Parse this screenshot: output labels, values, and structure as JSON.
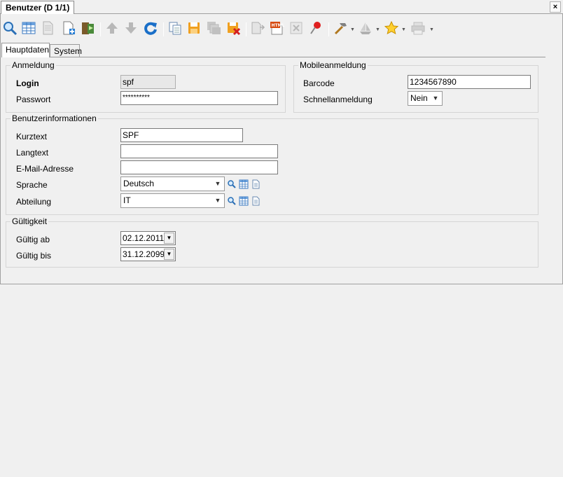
{
  "window": {
    "tab_title": "Benutzer (D 1/1)",
    "close_glyph": "×"
  },
  "tabs": [
    {
      "label": "Hauptdaten"
    },
    {
      "label": "System"
    }
  ],
  "anmeldung": {
    "title": "Anmeldung",
    "login_label": "Login",
    "login_value": "spf",
    "passwort_label": "Passwort",
    "passwort_value": "**********"
  },
  "mobile": {
    "title": "Mobileanmeldung",
    "barcode_label": "Barcode",
    "barcode_value": "1234567890",
    "schnell_label": "Schnellanmeldung",
    "schnell_value": "Nein"
  },
  "benutzerinfo": {
    "title": "Benutzerinformationen",
    "kurztext_label": "Kurztext",
    "kurztext_value": "SPF",
    "langtext_label": "Langtext",
    "langtext_value": "",
    "email_label": "E-Mail-Adresse",
    "email_value": "",
    "sprache_label": "Sprache",
    "sprache_value": "Deutsch",
    "abteilung_label": "Abteilung",
    "abteilung_value": "IT"
  },
  "gueltigkeit": {
    "title": "Gültigkeit",
    "ab_label": "Gültig ab",
    "ab_value": "02.12.2011",
    "bis_label": "Gültig bis",
    "bis_value": "31.12.2099"
  }
}
